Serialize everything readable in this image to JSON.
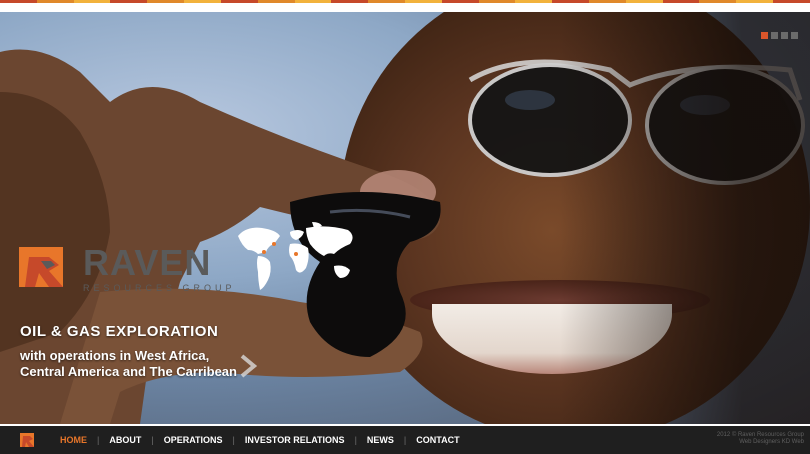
{
  "colors": {
    "accent": "#e8762a",
    "stripe": [
      "#c6492a",
      "#e0892a",
      "#f2b23c",
      "#c6492a",
      "#e0892a",
      "#f2b23c",
      "#c6492a",
      "#e0892a",
      "#f2b23c",
      "#c6492a",
      "#e0892a",
      "#f2b23c",
      "#c6492a",
      "#e0892a",
      "#f2b23c",
      "#c6492a",
      "#e0892a",
      "#f2b23c",
      "#c6492a",
      "#e0892a",
      "#f2b23c",
      "#c6492a"
    ],
    "nav_bg": "#1f1f1f"
  },
  "brand": {
    "name": "RAVEN",
    "tagline": "RESOURCES GROUP",
    "logo_icon": "raven-logo-icon"
  },
  "hero": {
    "headline": "OIL & GAS EXPLORATION",
    "subtext": "with operations in West Africa, Central America and The Carribean",
    "map_icon": "world-map-icon",
    "next_icon": "chevron-right-icon",
    "slide_count": 4,
    "active_slide": 1
  },
  "nav": {
    "items": [
      {
        "label": "HOME",
        "active": true
      },
      {
        "label": "ABOUT",
        "active": false
      },
      {
        "label": "OPERATIONS",
        "active": false
      },
      {
        "label": "INVESTOR RELATIONS",
        "active": false
      },
      {
        "label": "NEWS",
        "active": false
      },
      {
        "label": "CONTACT",
        "active": false
      }
    ],
    "separator": "|"
  },
  "footer": {
    "copyright": "2012 © Raven Resources Group",
    "credit": "Web Designers KD Web"
  }
}
